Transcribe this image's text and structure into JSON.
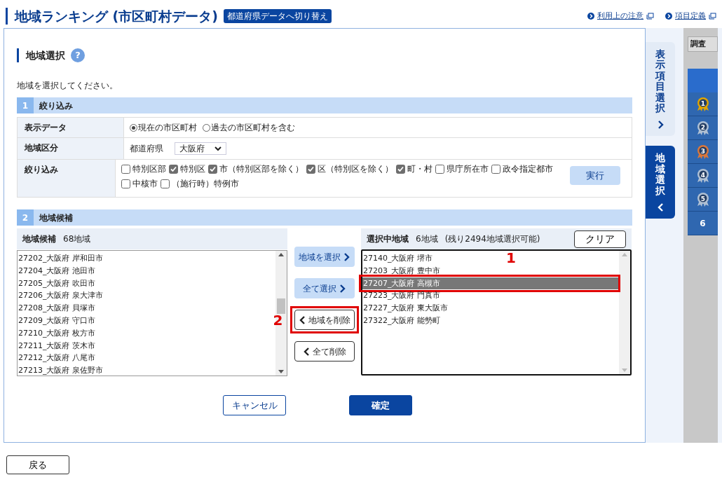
{
  "header": {
    "title": "地域ランキング (市区町村データ)",
    "switch_button": "都道府県データへ切り替え",
    "links": [
      "利用上の注意",
      "項目定義"
    ]
  },
  "section": {
    "title": "地域選択",
    "help": "?",
    "instruction": "地域を選択してください。"
  },
  "filter": {
    "number": "1",
    "title": "絞り込み",
    "rows": [
      {
        "kind": "radio",
        "label": "表示データ",
        "options": [
          {
            "label": "現在の市区町村",
            "selected": true
          },
          {
            "label": "過去の市区町村を含む",
            "selected": false
          }
        ]
      },
      {
        "kind": "select",
        "label": "地域区分",
        "field_label": "都道府県",
        "value": "大阪府"
      },
      {
        "kind": "checkbox",
        "label": "絞り込み",
        "button": "実行",
        "options": [
          {
            "label": "特別区部",
            "checked": false
          },
          {
            "label": "特別区",
            "checked": true
          },
          {
            "label": "市（特別区部を除く）",
            "checked": true
          },
          {
            "label": "区（特別区を除く）",
            "checked": true
          },
          {
            "label": "町・村",
            "checked": true
          },
          {
            "label": "県庁所在市",
            "checked": false
          },
          {
            "label": "政令指定都市",
            "checked": false
          },
          {
            "label": "中核市",
            "checked": false
          },
          {
            "label": "（施行時）特例市",
            "checked": false
          }
        ]
      }
    ]
  },
  "candidates": {
    "number": "2",
    "title": "地域候補",
    "available": {
      "title": "地域候補",
      "count": "68地域",
      "items": [
        "27202_大阪府 岸和田市",
        "27204_大阪府 池田市",
        "27205_大阪府 吹田市",
        "27206_大阪府 泉大津市",
        "27208_大阪府 貝塚市",
        "27209_大阪府 守口市",
        "27210_大阪府 枚方市",
        "27211_大阪府 茨木市",
        "27212_大阪府 八尾市",
        "27213_大阪府 泉佐野市"
      ]
    },
    "actions": [
      {
        "label": "地域を選択",
        "kind": "add"
      },
      {
        "label": "全て選択",
        "kind": "add"
      },
      {
        "label": "地域を削除",
        "kind": "remove",
        "annotation": "2"
      },
      {
        "label": "全て削除",
        "kind": "remove"
      }
    ],
    "chosen": {
      "title": "選択中地域",
      "count": "6地域",
      "remaining": "(残り2494地域選択可能)",
      "clear": "クリア",
      "items": [
        {
          "label": "27140_大阪府 堺市",
          "selected": false
        },
        {
          "label": "27203_大阪府 豊中市",
          "selected": false
        },
        {
          "label": "27207_大阪府 高槻市",
          "selected": true,
          "annotation": "1"
        },
        {
          "label": "27223_大阪府 門真市",
          "selected": false
        },
        {
          "label": "27227_大阪府 東大阪市",
          "selected": false
        },
        {
          "label": "27322_大阪府 能勢町",
          "selected": false
        }
      ]
    }
  },
  "footer_buttons": [
    {
      "label": "キャンセル",
      "kind": "secondary"
    },
    {
      "label": "確定",
      "kind": "primary"
    }
  ],
  "side_tabs": [
    {
      "label": "表示項目選択",
      "selected": false
    },
    {
      "label": "地域選択",
      "selected": true
    }
  ],
  "ranking_strip": {
    "header": "調査",
    "ranks": [
      {
        "label": "1",
        "kind": "medal",
        "color": "#e0a400"
      },
      {
        "label": "2",
        "kind": "medal",
        "color": "#aebfd3"
      },
      {
        "label": "3",
        "kind": "medal",
        "color": "#d9773b"
      },
      {
        "label": "4",
        "kind": "medal",
        "color": "#aebfd3"
      },
      {
        "label": "5",
        "kind": "medal",
        "color": "#aebfd3"
      },
      {
        "label": "6",
        "kind": "plain"
      }
    ]
  },
  "back_button": "戻る"
}
